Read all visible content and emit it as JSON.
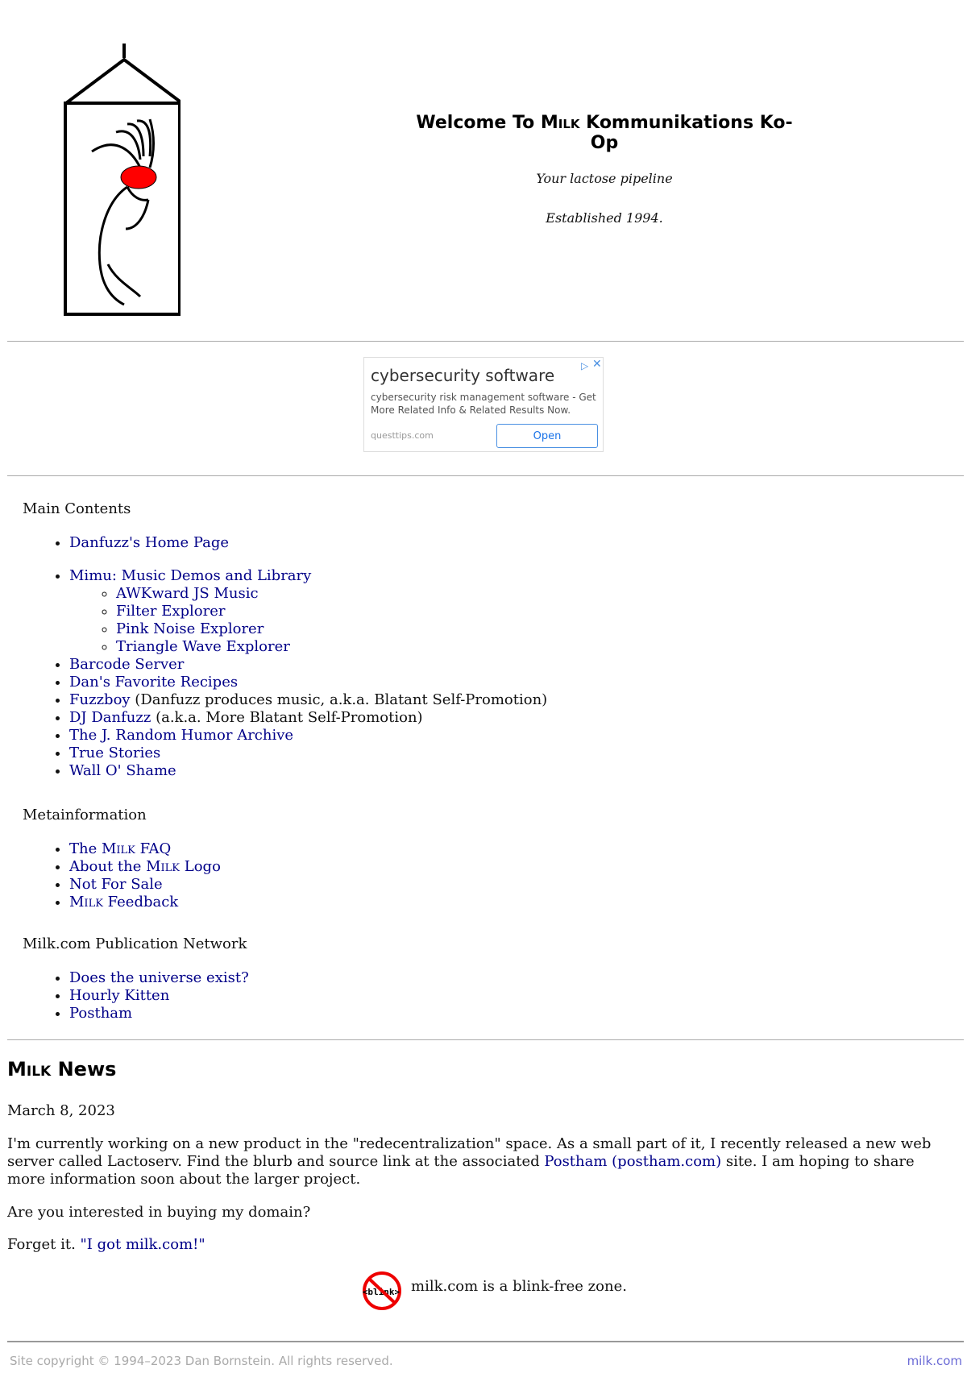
{
  "header": {
    "welcome_prefix": "Welcome To ",
    "welcome_brand": "Milk",
    "welcome_suffix": " Kommunikations Ko-Op",
    "tagline": "Your lactose pipeline",
    "established": "Established 1994."
  },
  "ad": {
    "title": "cybersecurity software",
    "description": "cybersecurity risk management software - Get More Related Info & Related Results Now.",
    "domain": "questtips.com",
    "button_label": "Open"
  },
  "main_contents": {
    "heading": "Main Contents",
    "home_page": "Danfuzz's Home Page",
    "mimu": "Mimu: Music Demos and Library",
    "mimu_sub": [
      "AWKward JS Music",
      "Filter Explorer",
      "Pink Noise Explorer",
      "Triangle Wave Explorer"
    ],
    "barcode": "Barcode Server",
    "recipes": "Dan's Favorite Recipes",
    "fuzzboy": "Fuzzboy",
    "fuzzboy_note": " (Danfuzz produces music, a.k.a. Blatant Self-Promotion)",
    "dj": "DJ Danfuzz",
    "dj_note": " (a.k.a. More Blatant Self-Promotion)",
    "humor": "The J. Random Humor Archive",
    "true_stories": "True Stories",
    "wall": "Wall O' Shame"
  },
  "metainformation": {
    "heading": "Metainformation",
    "faq_prefix": "The ",
    "faq_brand": "Milk",
    "faq_suffix": " FAQ",
    "logo_prefix": "About the ",
    "logo_brand": "Milk",
    "logo_suffix": " Logo",
    "not_for_sale": "Not For Sale",
    "feedback_brand": "Milk",
    "feedback_suffix": " Feedback"
  },
  "publication_network": {
    "heading": "Milk.com Publication Network",
    "items": [
      "Does the universe exist?",
      "Hourly Kitten",
      "Postham"
    ]
  },
  "news": {
    "title_brand": "Milk",
    "title_suffix": " News",
    "date": "March 8, 2023",
    "p1_before": "I'm currently working on a new product in the \"redecentralization\" space. As a small part of it, I recently released a new web server called Lactoserv. Find the blurb and source link at the associated ",
    "p1_link": "Postham (postham.com)",
    "p1_after": " site. I am hoping to share more information soon about the larger project.",
    "question": "Are you interested in buying my domain?",
    "forget_prefix": "Forget it. ",
    "forget_link": "\"I got milk.com!\""
  },
  "blink": {
    "icon_text": "<blink>",
    "text": "milk.com is a blink-free zone."
  },
  "footer": {
    "copyright": "Site copyright © 1994–2023 Dan Bornstein. All rights reserved.",
    "link": "milk.com"
  },
  "colors": {
    "link": "#000088",
    "logo_red": "#ff0000",
    "rule": "#aaaaaa"
  }
}
